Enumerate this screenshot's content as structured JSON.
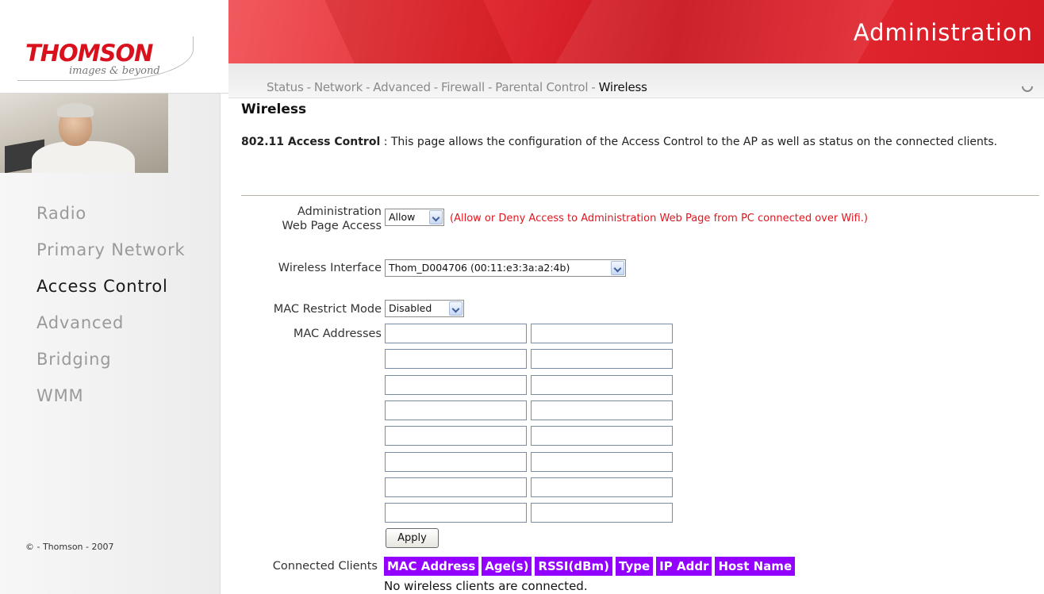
{
  "brand": {
    "name": "THOMSON",
    "tagline": "images & beyond"
  },
  "banner": {
    "title": "Administration"
  },
  "nav": {
    "items": [
      "Status",
      "Network",
      "Advanced",
      "Firewall",
      "Parental Control",
      "Wireless"
    ],
    "separator": "-",
    "active": "Wireless"
  },
  "sidebar": {
    "items": [
      "Radio",
      "Primary Network",
      "Access Control",
      "Advanced",
      "Bridging",
      "WMM"
    ],
    "active": "Access Control",
    "copyright": "© - Thomson - 2007"
  },
  "page": {
    "title": "Wireless",
    "intro_bold": "802.11 Access Control",
    "intro_text": " :  This page allows the configuration of the Access Control to the AP as well as status on the connected clients."
  },
  "form": {
    "admin_access": {
      "label_line1": "Administration",
      "label_line2": "Web Page Access",
      "value": "Allow",
      "hint": "(Allow or Deny Access to Administration Web Page from PC connected over Wifi.)"
    },
    "wireless_interface": {
      "label": "Wireless Interface",
      "value": "Thom_D004706 (00:11:e3:3a:a2:4b)"
    },
    "mac_restrict_mode": {
      "label": "MAC Restrict Mode",
      "value": "Disabled"
    },
    "mac_addresses": {
      "label": "MAC Addresses",
      "values": [
        "",
        "",
        "",
        "",
        "",
        "",
        "",
        "",
        "",
        "",
        "",
        "",
        "",
        "",
        "",
        ""
      ]
    },
    "apply_label": "Apply"
  },
  "clients": {
    "label": "Connected Clients",
    "columns": [
      "MAC Address",
      "Age(s)",
      "RSSI(dBm)",
      "Type",
      "IP Addr",
      "Host Name"
    ],
    "empty_message": "No wireless clients are connected.",
    "header_color": "#9400ff"
  },
  "colors": {
    "brand_red": "#d8111d",
    "hint_red": "#e0171f"
  }
}
